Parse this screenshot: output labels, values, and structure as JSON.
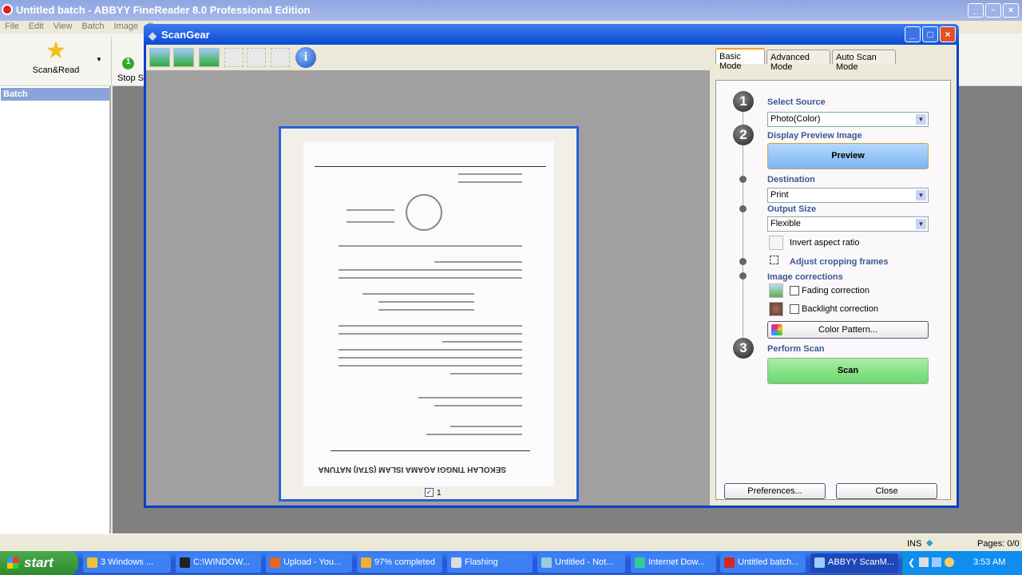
{
  "main_window": {
    "title": "Untitled batch - ABBYY FineReader 8.0 Professional Edition",
    "menu": [
      "File",
      "Edit",
      "View",
      "Batch",
      "Image",
      "Pr"
    ],
    "toolbar": {
      "scan_read": "Scan&Read",
      "stop_scan": "Stop Sc"
    },
    "left_panel": {
      "header": "Batch"
    }
  },
  "scangear": {
    "title": "ScanGear",
    "tabs": [
      {
        "label": "Basic Mode",
        "active": true
      },
      {
        "label": "Advanced Mode"
      },
      {
        "label": "Auto Scan Mode"
      }
    ],
    "steps": {
      "one": "1",
      "two": "2",
      "three": "3"
    },
    "select_source": {
      "label": "Select Source",
      "value": "Photo(Color)"
    },
    "display_preview": {
      "label": "Display Preview Image",
      "button": "Preview"
    },
    "destination": {
      "label": "Destination",
      "value": "Print"
    },
    "output_size": {
      "label": "Output Size",
      "value": "Flexible"
    },
    "invert_aspect": "Invert aspect ratio",
    "adjust_cropping": "Adjust cropping frames",
    "image_corrections": {
      "label": "Image corrections",
      "fading": {
        "label": "Fading correction",
        "checked": false
      },
      "backlight": {
        "label": "Backlight correction",
        "checked": false
      },
      "color_pattern": "Color Pattern..."
    },
    "perform_scan": {
      "label": "Perform Scan",
      "button": "Scan"
    },
    "preferences": "Preferences...",
    "close": "Close",
    "preview": {
      "page_number": "1",
      "page_checked": true,
      "document_heading": "SEKOLAH TINGGI AGAMA ISLAM (STAI) NATUNA"
    },
    "colors": {
      "preview_button": "#8fc0f8",
      "scan_button": "#8ee08e",
      "heading": "#3a5a90"
    }
  },
  "status_bar": {
    "ins": "INS",
    "pages": "Pages: 0/0"
  },
  "taskbar": {
    "start": "start",
    "items": [
      {
        "label": "3 Windows ...",
        "icon": "folder-icon"
      },
      {
        "label": "C:\\WINDOW...",
        "icon": "cmd-icon"
      },
      {
        "label": "Upload - You...",
        "icon": "firefox-icon"
      },
      {
        "label": "97% completed",
        "icon": "download-icon"
      },
      {
        "label": "Flashing",
        "icon": "window-icon"
      },
      {
        "label": "Untitled - Not...",
        "icon": "notepad-icon"
      },
      {
        "label": "Internet Dow...",
        "icon": "idm-icon"
      },
      {
        "label": "Untitled batch...",
        "icon": "finereader-icon"
      },
      {
        "label": "ABBYY ScanM...",
        "icon": "scanner-icon",
        "active": true
      }
    ],
    "clock": "3:53 AM"
  }
}
